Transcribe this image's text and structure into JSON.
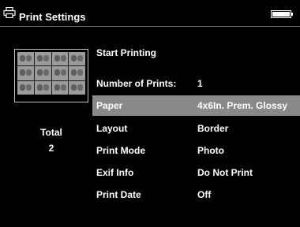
{
  "header": {
    "title": "Print Settings",
    "icon": "printer-icon",
    "battery_icon": "battery-icon"
  },
  "preview": {
    "thumbnail_icon": "print-preview-thumbnail",
    "total_label": "Total",
    "total_value": "2"
  },
  "menu": {
    "start_label": "Start Printing",
    "items": [
      {
        "label": "Number of Prints:",
        "value": "1",
        "selected": false
      },
      {
        "label": "Paper",
        "value": "4x6In. Prem. Glossy",
        "selected": true
      },
      {
        "label": "Layout",
        "value": "Border",
        "selected": false
      },
      {
        "label": "Print Mode",
        "value": "Photo",
        "selected": false
      },
      {
        "label": "Exif Info",
        "value": "Do Not Print",
        "selected": false
      },
      {
        "label": "Print Date",
        "value": "Off",
        "selected": false
      }
    ]
  },
  "colors": {
    "background": "#000000",
    "text": "#ffffff",
    "selection": "#898989"
  }
}
